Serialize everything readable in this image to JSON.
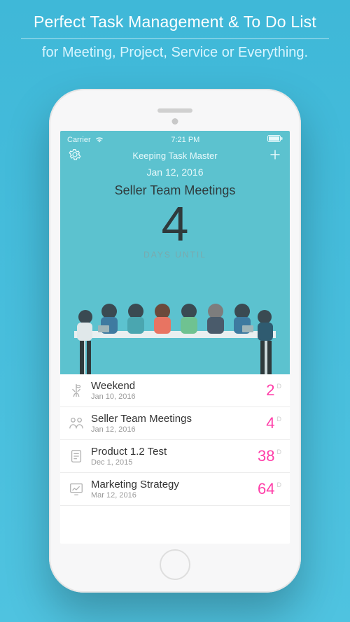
{
  "promo": {
    "title": "Perfect Task Management & To Do List",
    "subtitle": "for Meeting, Project, Service or Everything."
  },
  "status": {
    "carrier": "Carrier",
    "time": "7:21 PM"
  },
  "appbar": {
    "title": "Keeping Task Master"
  },
  "hero": {
    "date": "Jan 12, 2016",
    "event": "Seller Team Meetings",
    "count": "4",
    "label": "DAYS UNTIL"
  },
  "tasks": [
    {
      "title": "Weekend",
      "date": "Jan 10, 2016",
      "days": "2",
      "unit": "D"
    },
    {
      "title": "Seller Team Meetings",
      "date": "Jan 12, 2016",
      "days": "4",
      "unit": "D"
    },
    {
      "title": "Product 1.2 Test",
      "date": "Dec 1, 2015",
      "days": "38",
      "unit": "D"
    },
    {
      "title": "Marketing Strategy",
      "date": "Mar 12, 2016",
      "days": "64",
      "unit": "D"
    }
  ],
  "colors": {
    "accent": "#ff3da8",
    "hero_bg": "#5cc2cf"
  }
}
